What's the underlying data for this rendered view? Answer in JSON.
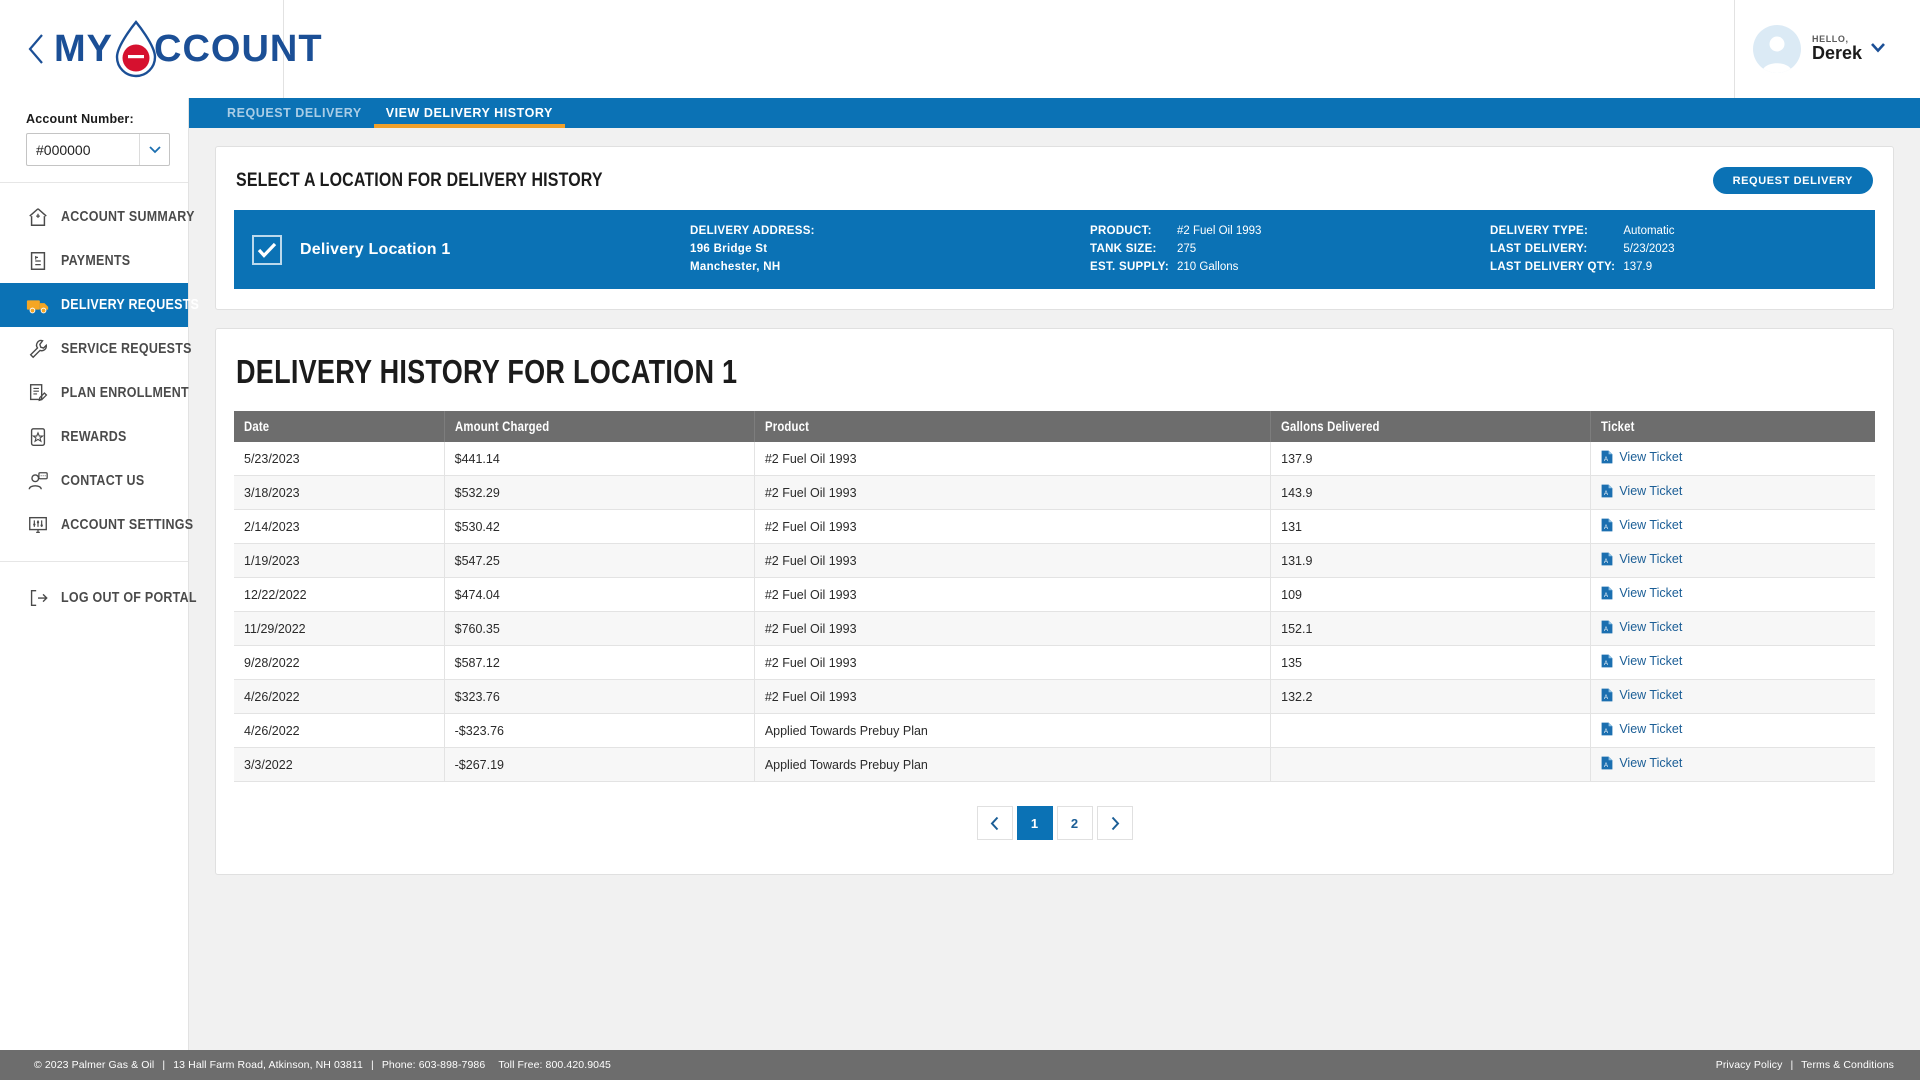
{
  "header": {
    "back_icon": "chevron-left-icon",
    "logo_part1": "MY",
    "logo_drop": "droplet-a-icon",
    "logo_part2": "CCOUNT",
    "user_hello": "HELLO,",
    "user_name": "Derek",
    "user_caret": "chevron-down-icon",
    "avatar_icon": "user-avatar-icon"
  },
  "sidebar": {
    "account_label": "Account Number:",
    "account_value": "#000000",
    "account_caret": "chevron-down-icon",
    "items": [
      {
        "label": "Account Summary",
        "icon": "home-icon",
        "active": false
      },
      {
        "label": "Payments",
        "icon": "invoice-icon",
        "active": false
      },
      {
        "label": "Delivery Requests",
        "icon": "delivery-truck-icon",
        "active": true
      },
      {
        "label": "Service Requests",
        "icon": "wrench-icon",
        "active": false
      },
      {
        "label": "Plan Enrollment",
        "icon": "document-pencil-icon",
        "active": false
      },
      {
        "label": "Rewards",
        "icon": "star-badge-icon",
        "active": false
      },
      {
        "label": "Contact Us",
        "icon": "person-chat-icon",
        "active": false
      },
      {
        "label": "Account Settings",
        "icon": "monitor-sliders-icon",
        "active": false
      }
    ],
    "logout": {
      "label": "Log Out Of Portal",
      "icon": "logout-icon"
    }
  },
  "tabs": [
    {
      "label": "Request Delivery",
      "active": false
    },
    {
      "label": "View Delivery History",
      "active": true
    }
  ],
  "location_panel": {
    "title": "Select a Location for Delivery History",
    "request_button": "Request Delivery",
    "location": {
      "selected": true,
      "check_icon": "checkmark-icon",
      "name": "Delivery Location 1",
      "address_label": "DELIVERY ADDRESS:",
      "address_line1": "196 Bridge St",
      "address_line2": "Manchester, NH",
      "product_keys": "PRODUCT:\nTANK SIZE:\nEST. SUPPLY:",
      "product_label": "PRODUCT:",
      "product_value": "#2 Fuel Oil 1993",
      "tank_label": "TANK SIZE:",
      "tank_value": "275",
      "supply_label": "EST. SUPPLY:",
      "supply_value": "210 Gallons",
      "delivery_type_label": "DELIVERY TYPE:",
      "delivery_type_value": "Automatic",
      "last_delivery_label": "LAST DELIVERY:",
      "last_delivery_value": "5/23/2023",
      "last_qty_label": "LAST DELIVERY QTY:",
      "last_qty_value": "137.9"
    }
  },
  "history": {
    "title": "Delivery History for Location 1",
    "columns": [
      "Date",
      "Amount Charged",
      "Product",
      "Gallons Delivered",
      "Ticket"
    ],
    "ticket_link_label": "View Ticket",
    "ticket_icon": "pdf-file-icon",
    "rows": [
      {
        "date": "5/23/2023",
        "amount": "$441.14",
        "product": "#2 Fuel Oil 1993",
        "gallons": "137.9",
        "ticket": "View Ticket"
      },
      {
        "date": "3/18/2023",
        "amount": "$532.29",
        "product": "#2 Fuel Oil 1993",
        "gallons": "143.9",
        "ticket": "View Ticket"
      },
      {
        "date": "2/14/2023",
        "amount": "$530.42",
        "product": "#2 Fuel Oil 1993",
        "gallons": "131",
        "ticket": "View Ticket"
      },
      {
        "date": "1/19/2023",
        "amount": "$547.25",
        "product": "#2 Fuel Oil 1993",
        "gallons": "131.9",
        "ticket": "View Ticket"
      },
      {
        "date": "12/22/2022",
        "amount": "$474.04",
        "product": "#2 Fuel Oil 1993",
        "gallons": "109",
        "ticket": "View Ticket"
      },
      {
        "date": "11/29/2022",
        "amount": "$760.35",
        "product": "#2 Fuel Oil 1993",
        "gallons": "152.1",
        "ticket": "View Ticket"
      },
      {
        "date": "9/28/2022",
        "amount": "$587.12",
        "product": "#2 Fuel Oil 1993",
        "gallons": "135",
        "ticket": "View Ticket"
      },
      {
        "date": "4/26/2022",
        "amount": "$323.76",
        "product": "#2 Fuel Oil 1993",
        "gallons": "132.2",
        "ticket": "View Ticket"
      },
      {
        "date": "4/26/2022",
        "amount": "-$323.76",
        "product": "Applied Towards Prebuy Plan",
        "gallons": "",
        "ticket": "View Ticket"
      },
      {
        "date": "3/3/2022",
        "amount": "-$267.19",
        "product": "Applied Towards Prebuy Plan",
        "gallons": "",
        "ticket": "View Ticket"
      }
    ],
    "pagination": {
      "prev_icon": "chevron-left-icon",
      "next_icon": "chevron-right-icon",
      "pages": [
        "1",
        "2"
      ],
      "current": "1"
    }
  },
  "footer": {
    "copyright": "© 2023 Palmer Gas & Oil",
    "address": "13 Hall Farm Road, Atkinson, NH 03811",
    "phone": "Phone: 603-898-7986",
    "tollfree": "Toll Free: 800.420.9045",
    "privacy": "Privacy Policy",
    "terms": "Terms & Conditions"
  },
  "colors": {
    "brand_blue": "#0b72b5",
    "logo_navy": "#1b4f96",
    "accent_orange": "#f0a02a",
    "drop_red": "#d6112f",
    "table_header_gray": "#6d6d6d",
    "link_blue": "#1b5e96"
  }
}
